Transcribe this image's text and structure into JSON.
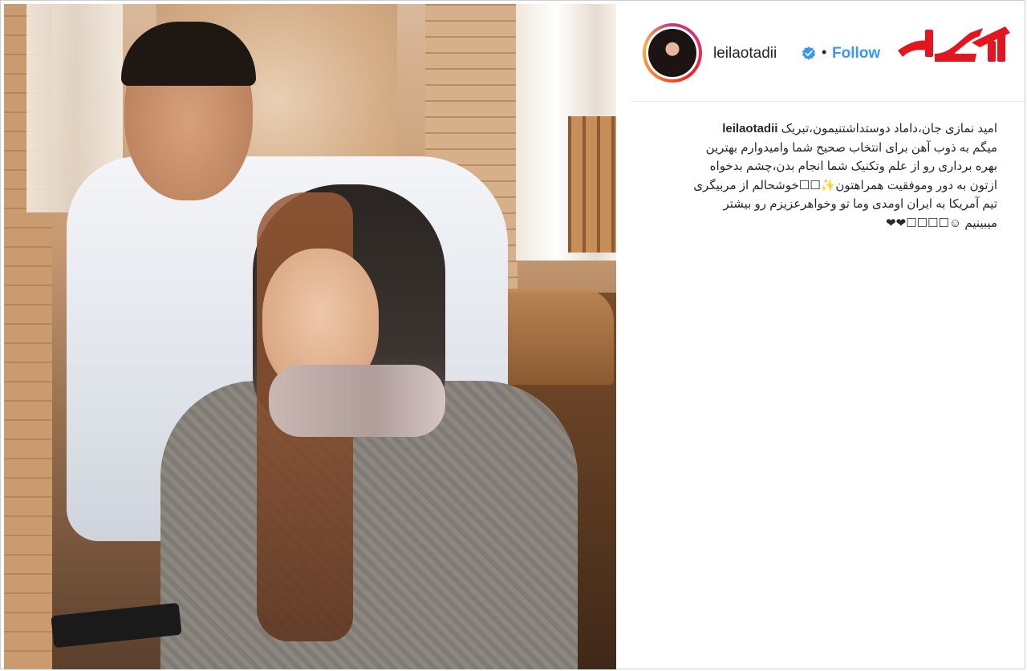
{
  "post": {
    "username": "leilaotadii",
    "verified_icon": "verified-badge-icon",
    "follow_label": "Follow",
    "separator": "•",
    "caption": {
      "lines": [
        "امید نمازی جان،داماد دوستداشتنیمون،تبریک",
        "میگم به ذوب آهن برای انتخاب صحیح شما وامیدوارم بهترین",
        "بهره برداری رو از علم وتکنیک شما انجام بدن،چشم بدخواه",
        "ازتون به دور وموفقیت همراهتون✨☐☐خوشحالم از مربیگری",
        "تیم آمریکا به ایران اومدی وما تو وخواهرعزیزم رو بیشتر",
        "میبینیم ☺☐☐☐☐❤❤"
      ]
    }
  },
  "branding": {
    "logo_icon": "rokna-logo-icon",
    "logo_color": "#e3161f"
  },
  "colors": {
    "follow": "#3897f0",
    "text": "#262626"
  }
}
